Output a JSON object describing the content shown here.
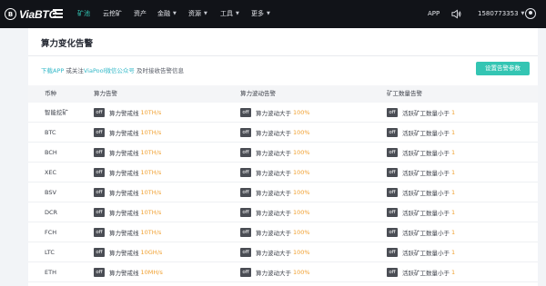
{
  "nav": {
    "logo_mark": "B",
    "logo_text": "ViaBTC",
    "items": [
      {
        "label": "矿池",
        "active": true,
        "dropdown": false
      },
      {
        "label": "云挖矿",
        "active": false,
        "dropdown": false
      },
      {
        "label": "资产",
        "active": false,
        "dropdown": false
      },
      {
        "label": "金融",
        "active": false,
        "dropdown": true
      },
      {
        "label": "资源",
        "active": false,
        "dropdown": true
      },
      {
        "label": "工具",
        "active": false,
        "dropdown": true
      },
      {
        "label": "更多",
        "active": false,
        "dropdown": true
      }
    ],
    "app_label": "APP",
    "account": "1580773353",
    "icons": [
      "menu-icon",
      "speaker-icon",
      "user-icon"
    ]
  },
  "page": {
    "title": "算力变化告警",
    "tip_link_app": "下载APP",
    "tip_mid": " 或关注",
    "tip_link_wechat": "ViaPool微信公众号",
    "tip_end": " 及时接收告警信息",
    "config_button": "设置告警参数"
  },
  "table": {
    "headers": [
      "币种",
      "算力告警",
      "算力波动告警",
      "矿工数量告警"
    ],
    "rows": [
      {
        "coin": "智能挖矿",
        "hash_label": "算力警戒线",
        "hash_value": "10TH/s",
        "fluct_label": "算力波动大于",
        "fluct_value": "100%",
        "miner_label": "活跃矿工数量小于",
        "miner_value": "1"
      },
      {
        "coin": "BTC",
        "hash_label": "算力警戒线",
        "hash_value": "10TH/s",
        "fluct_label": "算力波动大于",
        "fluct_value": "100%",
        "miner_label": "活跃矿工数量小于",
        "miner_value": "1"
      },
      {
        "coin": "BCH",
        "hash_label": "算力警戒线",
        "hash_value": "10TH/s",
        "fluct_label": "算力波动大于",
        "fluct_value": "100%",
        "miner_label": "活跃矿工数量小于",
        "miner_value": "1"
      },
      {
        "coin": "XEC",
        "hash_label": "算力警戒线",
        "hash_value": "10TH/s",
        "fluct_label": "算力波动大于",
        "fluct_value": "100%",
        "miner_label": "活跃矿工数量小于",
        "miner_value": "1"
      },
      {
        "coin": "BSV",
        "hash_label": "算力警戒线",
        "hash_value": "10TH/s",
        "fluct_label": "算力波动大于",
        "fluct_value": "100%",
        "miner_label": "活跃矿工数量小于",
        "miner_value": "1"
      },
      {
        "coin": "DCR",
        "hash_label": "算力警戒线",
        "hash_value": "10TH/s",
        "fluct_label": "算力波动大于",
        "fluct_value": "100%",
        "miner_label": "活跃矿工数量小于",
        "miner_value": "1"
      },
      {
        "coin": "FCH",
        "hash_label": "算力警戒线",
        "hash_value": "10TH/s",
        "fluct_label": "算力波动大于",
        "fluct_value": "100%",
        "miner_label": "活跃矿工数量小于",
        "miner_value": "1"
      },
      {
        "coin": "LTC",
        "hash_label": "算力警戒线",
        "hash_value": "10GH/s",
        "fluct_label": "算力波动大于",
        "fluct_value": "100%",
        "miner_label": "活跃矿工数量小于",
        "miner_value": "1"
      },
      {
        "coin": "ETH",
        "hash_label": "算力警戒线",
        "hash_value": "10MH/s",
        "fluct_label": "算力波动大于",
        "fluct_value": "100%",
        "miner_label": "活跃矿工数量小于",
        "miner_value": "1"
      }
    ],
    "toggle_label": "off"
  },
  "colors": {
    "nav_bg": "#111318",
    "accent": "#33c8b6",
    "value": "#f0a030",
    "toggle_bg": "#4a4d54"
  }
}
